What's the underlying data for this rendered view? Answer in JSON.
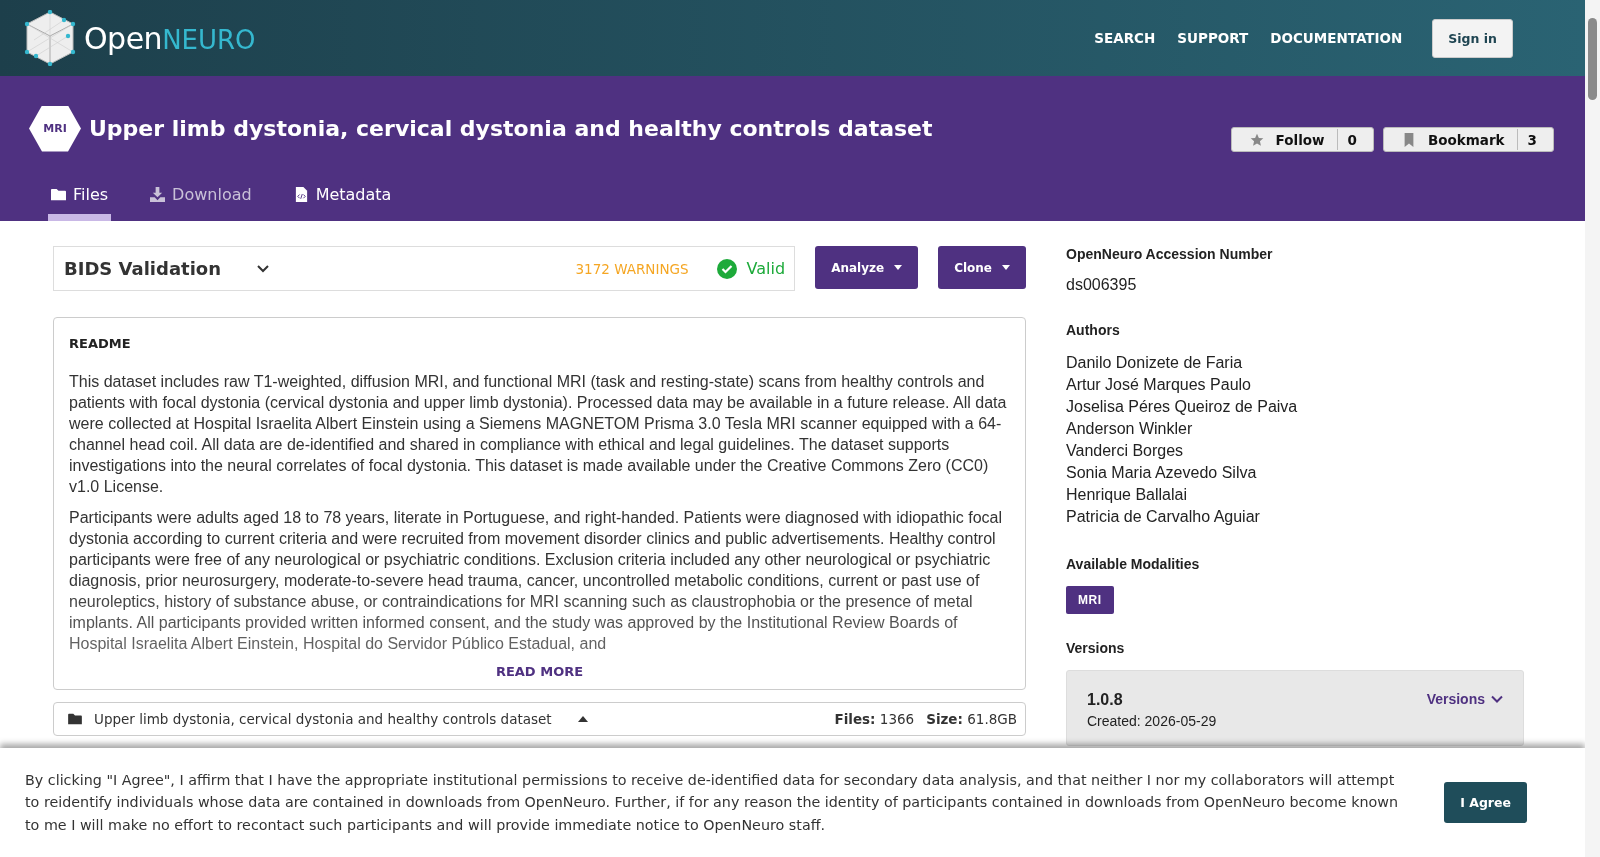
{
  "header": {
    "logo_open": "Open",
    "logo_neuro": "NEURO",
    "nav": [
      "SEARCH",
      "SUPPORT",
      "DOCUMENTATION"
    ],
    "sign_in": "Sign in"
  },
  "dataset": {
    "modality_badge": "MRI",
    "title": "Upper limb dystonia, cervical dystonia and healthy controls dataset",
    "follow": {
      "label": "Follow",
      "count": "0"
    },
    "bookmark": {
      "label": "Bookmark",
      "count": "3"
    }
  },
  "tabs": [
    {
      "kind": "folder",
      "label": "Files",
      "selected": true,
      "disabled": false
    },
    {
      "kind": "download",
      "label": "Download",
      "selected": false,
      "disabled": true
    },
    {
      "kind": "code-file",
      "label": "Metadata",
      "selected": false,
      "disabled": false
    }
  ],
  "validation": {
    "title": "BIDS Validation",
    "warnings": "3172 WARNINGS",
    "status": "Valid"
  },
  "actions": [
    "Analyze",
    "Clone"
  ],
  "readme": {
    "heading": "README",
    "paragraphs": [
      "This dataset includes raw T1-weighted, diffusion MRI, and functional MRI (task and resting-state) scans from healthy controls and patients with focal dystonia (cervical dystonia and upper limb dystonia). Processed data may be available in a future release. All data were collected at Hospital Israelita Albert Einstein using a Siemens MAGNETOM Prisma 3.0 Tesla MRI scanner equipped with a 64-channel head coil. All data are de-identified and shared in compliance with ethical and legal guidelines. The dataset supports investigations into the neural correlates of focal dystonia. This dataset is made available under the Creative Commons Zero (CC0) v1.0 License.",
      "Participants were adults aged 18 to 78 years, literate in Portuguese, and right-handed. Patients were diagnosed with idiopathic focal dystonia according to current criteria and were recruited from movement disorder clinics and public advertisements. Healthy control participants were free of any neurological or psychiatric conditions. Exclusion criteria included any other neurological or psychiatric diagnosis, prior neurosurgery, moderate-to-severe head trauma, cancer, uncontrolled metabolic conditions, current or past use of neuroleptics, history of substance abuse, or contraindications for MRI scanning such as claustrophobia or the presence of metal implants. All participants provided written informed consent, and the study was approved by the Institutional Review Boards of Hospital Israelita Albert Einstein, Hospital do Servidor Público Estadual, and"
    ],
    "read_more": "READ MORE"
  },
  "file_tree": {
    "name": "Upper limb dystonia, cervical dystonia and healthy controls dataset",
    "files_label": "Files:",
    "files": "1366",
    "size_label": "Size:",
    "size": "61.8GB"
  },
  "sidebar": {
    "accession_label": "OpenNeuro Accession Number",
    "accession": "ds006395",
    "authors_label": "Authors",
    "authors": [
      "Danilo Donizete de Faria",
      "Artur José Marques Paulo",
      "Joselisa Péres Queiroz de Paiva",
      "Anderson Winkler",
      "Vanderci Borges",
      "Sonia Maria Azevedo Silva",
      "Henrique Ballalai",
      "Patricia de Carvalho Aguiar"
    ],
    "modalities_label": "Available Modalities",
    "modalities": [
      "MRI"
    ],
    "versions_label": "Versions",
    "version": {
      "number": "1.0.8",
      "created": "Created: 2026-05-29",
      "menu": "Versions"
    }
  },
  "consent": {
    "text": "By clicking \"I Agree\", I affirm that I have the appropriate institutional permissions to receive de-identified data for secondary data analysis, and that neither I nor my collaborators will attempt to reidentify individuals whose data are contained in downloads from OpenNeuro. Further, if for any reason the identity of participants contained in downloads from OpenNeuro become known to me I will make no effort to recontact such participants and will provide immediate notice to OpenNeuro staff.",
    "button": "I Agree"
  }
}
